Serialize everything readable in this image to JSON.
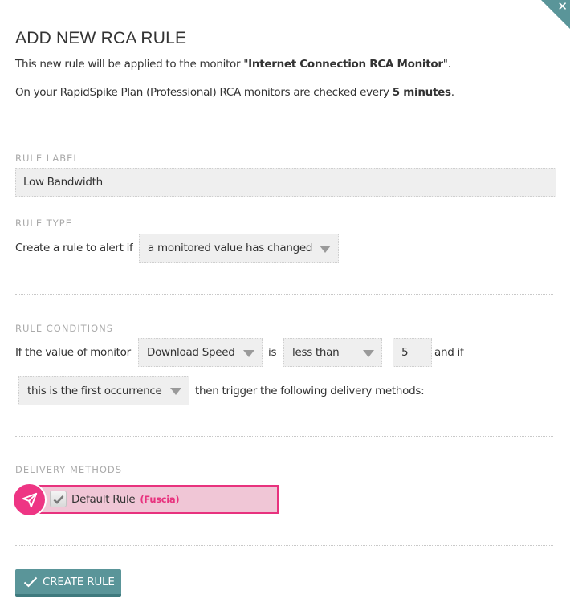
{
  "dialog": {
    "title": "ADD NEW RCA RULE",
    "intro": {
      "prefix": "This new rule will be applied to the monitor \"",
      "monitor_name": "Internet Connection RCA Monitor",
      "suffix": "\"."
    },
    "plan_note": {
      "prefix": "On your RapidSpike Plan (Professional) RCA monitors are checked every ",
      "interval": "5 minutes",
      "suffix": "."
    },
    "close_icon": "close-icon"
  },
  "rule_label": {
    "heading": "RULE LABEL",
    "value": "Low Bandwidth"
  },
  "rule_type": {
    "heading": "RULE TYPE",
    "prompt": "Create a rule to alert if",
    "selected": "a monitored value has changed"
  },
  "rule_conditions": {
    "heading": "RULE CONDITIONS",
    "prefix": "If the value of monitor",
    "metric_selected": "Download Speed",
    "is_label": "is",
    "operator_selected": "less than",
    "threshold_value": "5",
    "and_if_label": "and if",
    "occurrence_selected": "this is the first occurrence",
    "suffix": "then trigger the following delivery methods:"
  },
  "delivery_methods": {
    "heading": "DELIVERY METHODS",
    "items": [
      {
        "label": "Default Rule",
        "tag": "(Fuscia)",
        "checked": true,
        "icon": "send-icon"
      }
    ],
    "accent_color": "#e8327e"
  },
  "actions": {
    "create_label": "CREATE RULE",
    "button_color": "#5a9599"
  }
}
